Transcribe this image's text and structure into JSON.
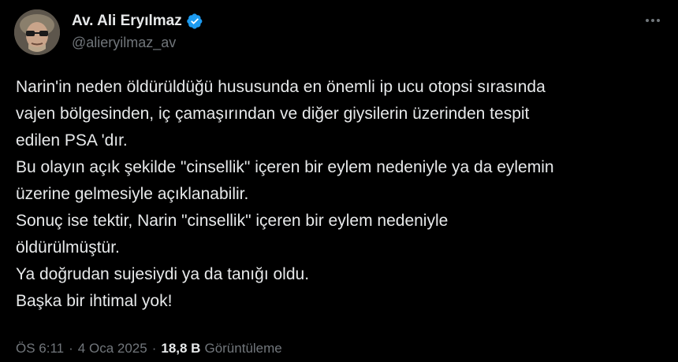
{
  "author": {
    "display_name": "Av. Ali Eryılmaz",
    "handle": "@alieryilmaz_av",
    "verified_badge_color": "#1d9bf0"
  },
  "tweet": {
    "lines": [
      "Narin'in neden öldürüldüğü hususunda en önemli ip ucu otopsi sırasında",
      "vajen bölgesinden, iç çamaşırından ve diğer giysilerin üzerinden tespit",
      "edilen PSA 'dır.",
      "Bu olayın açık şekilde \"cinsellik\" içeren bir eylem nedeniyle ya da eylemin",
      "üzerine gelmesiyle açıklanabilir.",
      "Sonuç ise tektir, Narin \"cinsellik\" içeren bir eylem nedeniyle",
      "öldürülmüştür.",
      "Ya doğrudan sujesiydi ya da tanığı oldu.",
      "Başka bir ihtimal yok!"
    ]
  },
  "meta": {
    "time": "ÖS 6:11",
    "separator": "·",
    "date": "4 Oca 2025",
    "views_count": "18,8 B",
    "views_label": "Görüntüleme"
  },
  "icons": {
    "more": "more-horizontal-icon",
    "verified": "verified-badge-icon"
  },
  "colors": {
    "background": "#000000",
    "text_primary": "#e7e9ea",
    "text_secondary": "#71767b"
  }
}
